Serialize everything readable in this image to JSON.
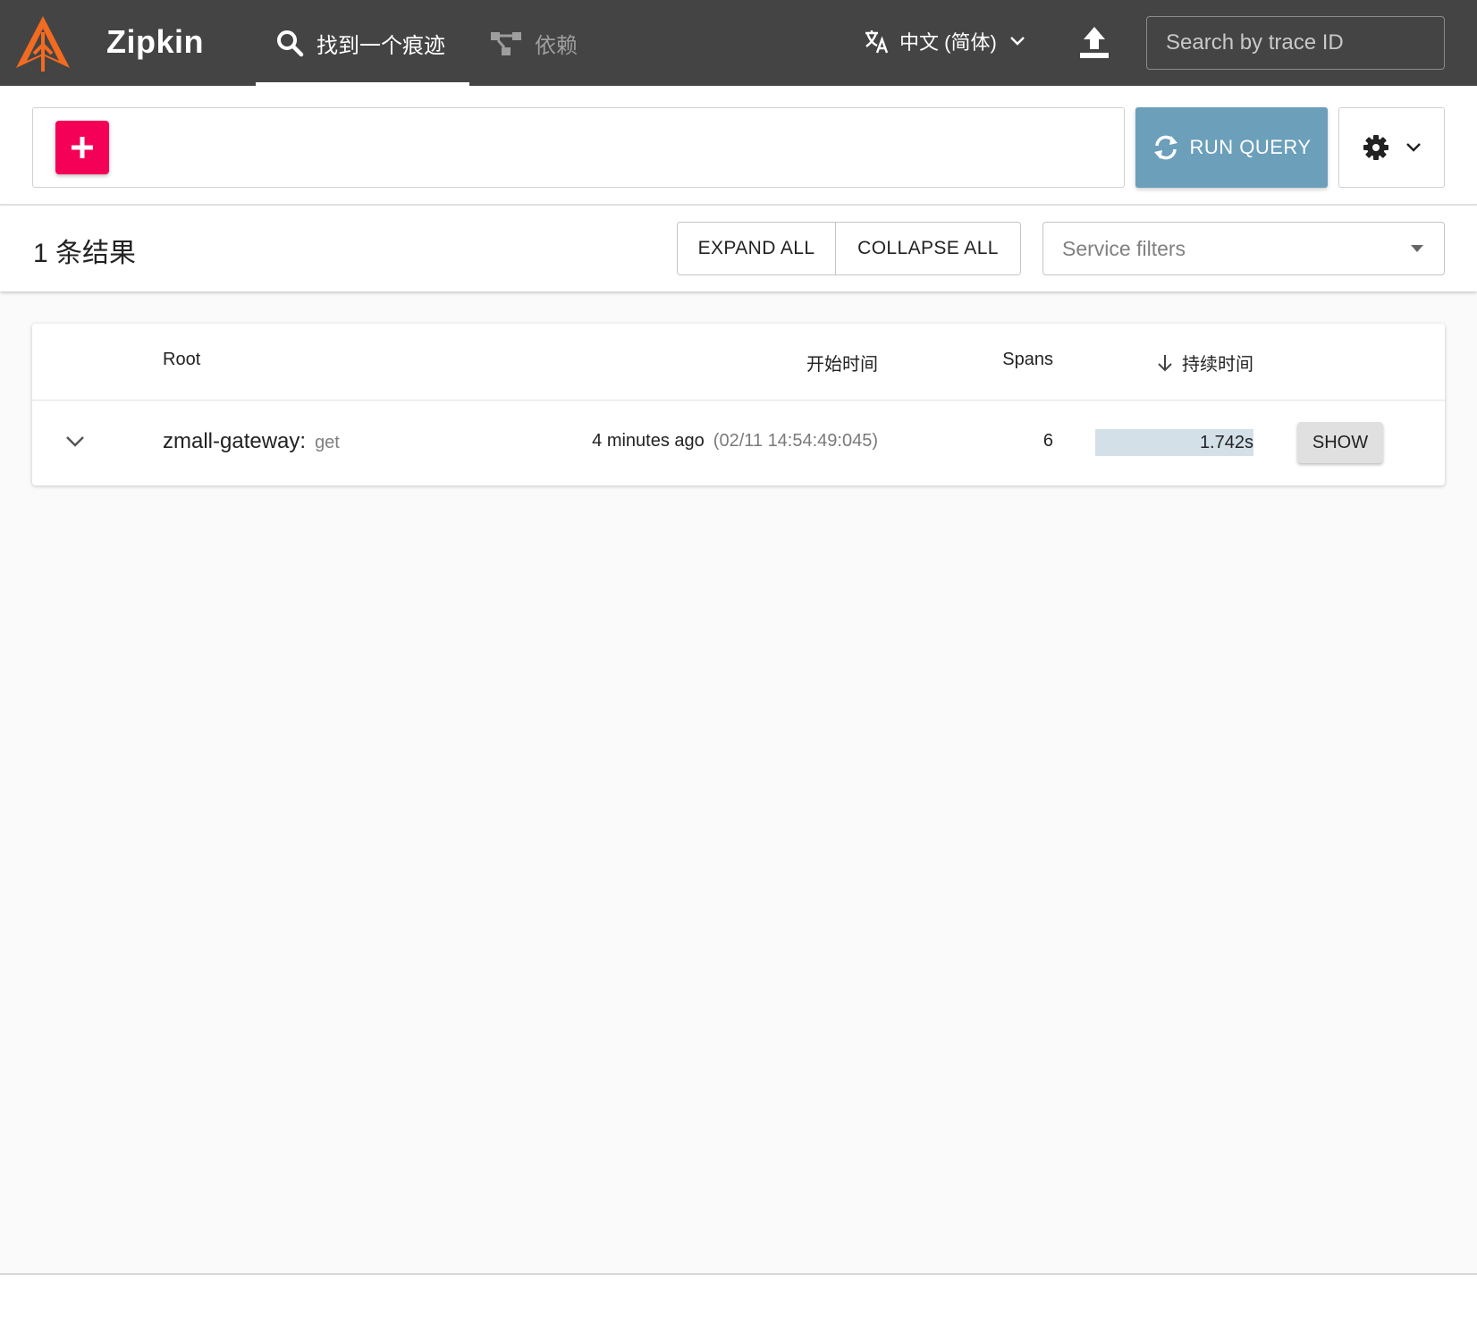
{
  "header": {
    "brand": "Zipkin",
    "nav": {
      "find_trace": "找到一个痕迹",
      "dependencies": "依赖"
    },
    "language": "中文 (简体)",
    "trace_search_placeholder": "Search by trace ID"
  },
  "query": {
    "run_label": "RUN QUERY"
  },
  "results": {
    "count_label": "1 条结果",
    "expand_all": "EXPAND ALL",
    "collapse_all": "COLLAPSE ALL",
    "service_filters_placeholder": "Service filters"
  },
  "table": {
    "columns": {
      "root": "Root",
      "start_time": "开始时间",
      "spans": "Spans",
      "duration": "持续时间"
    },
    "rows": [
      {
        "service": "zmall-gateway:",
        "operation": "get",
        "relative_time": "4 minutes ago",
        "absolute_time": "(02/11 14:54:49:045)",
        "spans": "6",
        "duration": "1.742s",
        "duration_fraction": 1.0,
        "show_label": "SHOW"
      }
    ]
  },
  "colors": {
    "appbar": "#444444",
    "add_button": "#f50057",
    "run_button": "#6b9fba",
    "duration_bar": "#d7e3ea",
    "logo_orange": "#f26b21"
  }
}
